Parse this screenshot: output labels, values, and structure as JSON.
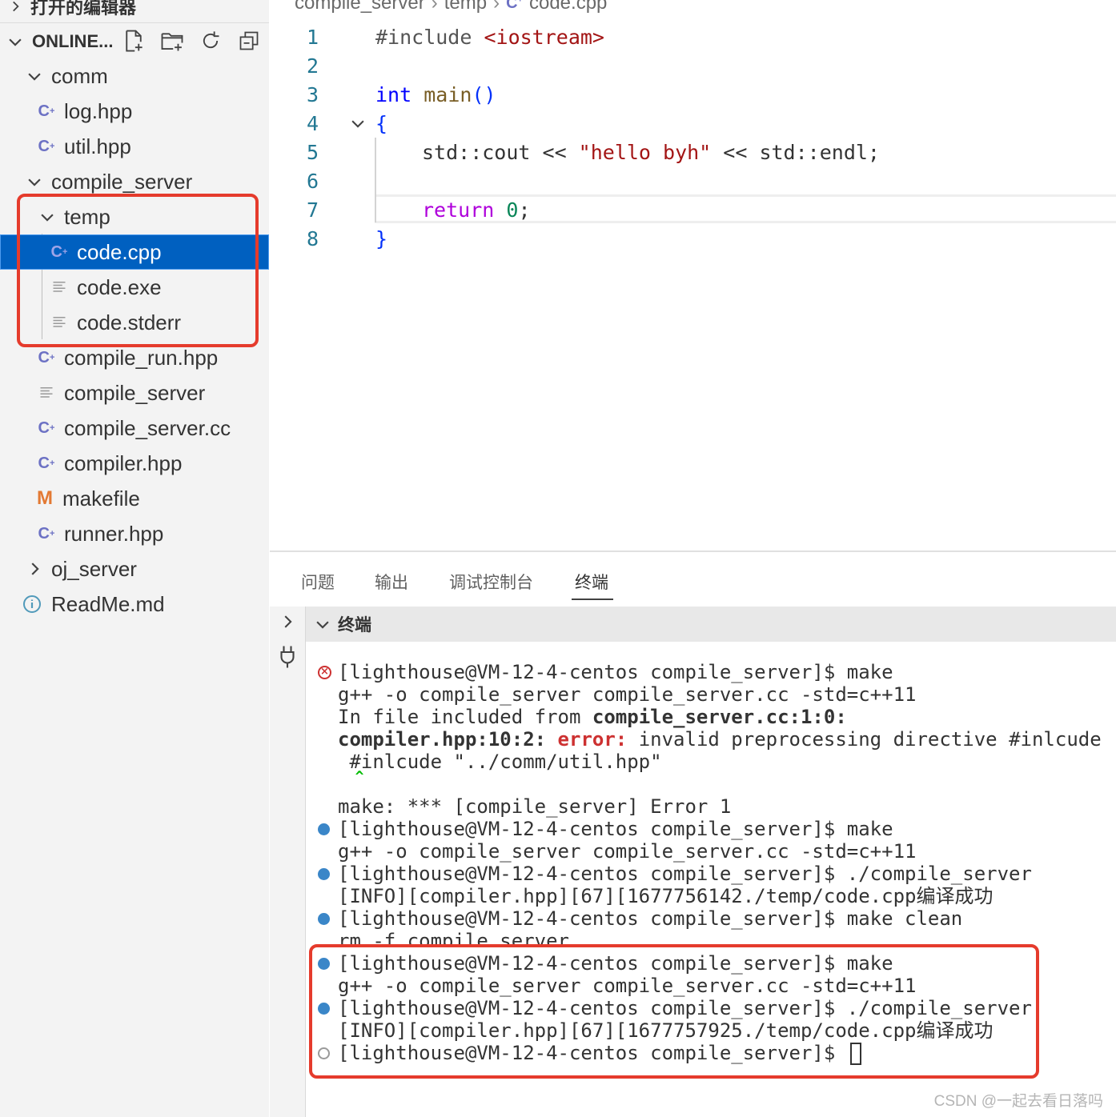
{
  "sidebar": {
    "open_editors_label": "打开的编辑器",
    "workspace_label": "ONLINE...",
    "toolbar_icons": [
      "new-file-icon",
      "new-folder-icon",
      "refresh-icon",
      "collapse-all-icon"
    ],
    "tree": [
      {
        "label": "comm",
        "type": "folder",
        "expanded": true
      },
      {
        "label": "log.hpp",
        "type": "cpp"
      },
      {
        "label": "util.hpp",
        "type": "cpp"
      },
      {
        "label": "compile_server",
        "type": "folder",
        "expanded": true
      },
      {
        "label": "temp",
        "type": "folder",
        "expanded": true
      },
      {
        "label": "code.cpp",
        "type": "cpp",
        "selected": true
      },
      {
        "label": "code.exe",
        "type": "text"
      },
      {
        "label": "code.stderr",
        "type": "text"
      },
      {
        "label": "compile_run.hpp",
        "type": "cpp"
      },
      {
        "label": "compile_server",
        "type": "text"
      },
      {
        "label": "compile_server.cc",
        "type": "cpp"
      },
      {
        "label": "compiler.hpp",
        "type": "cpp"
      },
      {
        "label": "makefile",
        "type": "makefile"
      },
      {
        "label": "runner.hpp",
        "type": "cpp"
      },
      {
        "label": "oj_server",
        "type": "folder",
        "expanded": false
      },
      {
        "label": "ReadMe.md",
        "type": "info"
      }
    ]
  },
  "breadcrumb": [
    "compile_server",
    "temp",
    "code.cpp"
  ],
  "editor": {
    "line_numbers": [
      "1",
      "2",
      "3",
      "4",
      "5",
      "6",
      "7",
      "8"
    ],
    "line1_directive": "#include ",
    "line1_header": "<iostream>",
    "line3_type": "int",
    "line3_func": "main",
    "line3_parens": "()",
    "line4_brace": "{",
    "line5_a": "std::cout << ",
    "line5_str": "\"hello byh\"",
    "line5_b": " << std::endl;",
    "line7_kw": "return",
    "line7_num": "0",
    "line7_semi": ";",
    "line8_brace": "}"
  },
  "panel": {
    "tabs": [
      "问题",
      "输出",
      "调试控制台",
      "终端"
    ],
    "active_tab": "终端",
    "terminal_title": "终端",
    "lines": [
      "[lighthouse@VM-12-4-centos compile_server]$ make",
      "g++ -o compile_server compile_server.cc -std=c++11",
      "In file included from ",
      "compile_server.cc:1:0:",
      "compiler.hpp:10:2:",
      "error:",
      " invalid preprocessing directive #inlcude",
      " #inlcude \"../comm/util.hpp\"",
      "  ^",
      "make: *** [compile_server] Error 1",
      "[lighthouse@VM-12-4-centos compile_server]$ make",
      "g++ -o compile_server compile_server.cc -std=c++11",
      "[lighthouse@VM-12-4-centos compile_server]$ ./compile_server",
      "[INFO][compiler.hpp][67][1677756142./temp/code.cpp编译成功",
      "[lighthouse@VM-12-4-centos compile_server]$ make clean",
      "rm -f compile_server",
      "[lighthouse@VM-12-4-centos compile_server]$ make",
      "g++ -o compile_server compile_server.cc -std=c++11",
      "[lighthouse@VM-12-4-centos compile_server]$ ./compile_server",
      "[INFO][compiler.hpp][67][1677757925./temp/code.cpp编译成功",
      "[lighthouse@VM-12-4-centos compile_server]$ "
    ]
  },
  "watermark": "CSDN @一起去看日落吗",
  "colors": {
    "selection": "#0060c0",
    "highlight_box": "#e53b2c",
    "cpp_icon": "#6c71c4",
    "makefile_icon": "#e37933",
    "info_icon": "#519aba"
  }
}
